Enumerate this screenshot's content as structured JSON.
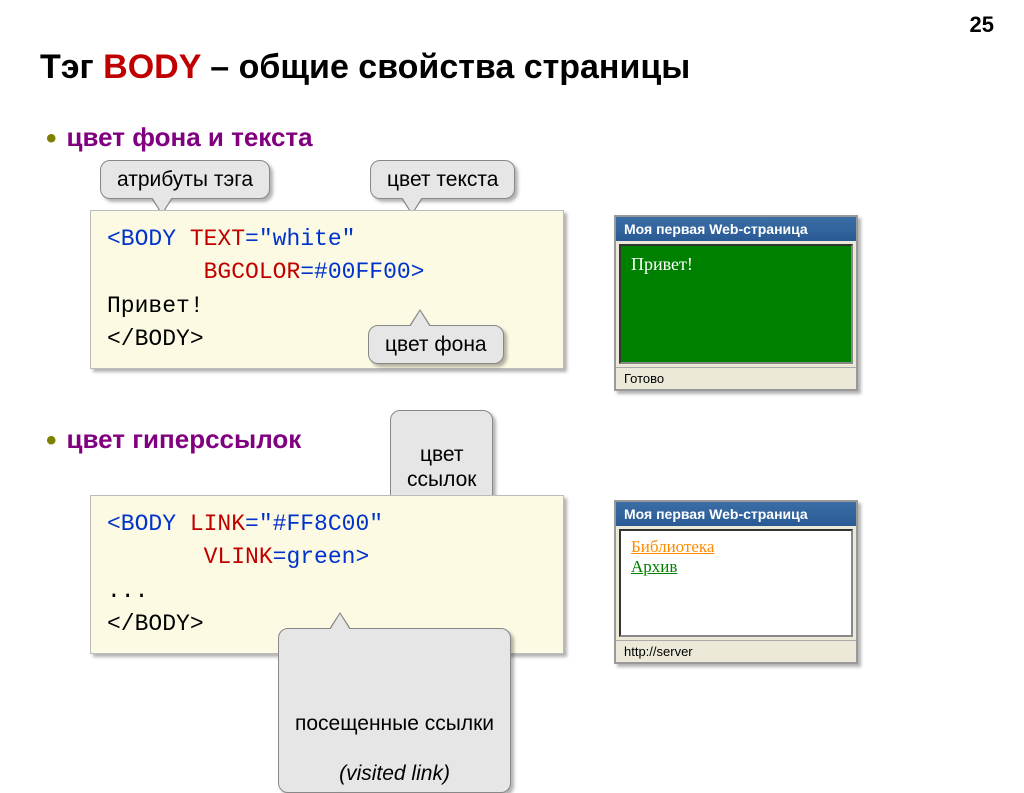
{
  "pageNumber": "25",
  "title": {
    "pre": "Тэг ",
    "kw": "BODY",
    "post": " – общие свойства страницы"
  },
  "bullet1": "цвет фона и текста",
  "bullet2": "цвет гиперссылок",
  "callouts": {
    "attrs": "атрибуты тэга",
    "textcolor": "цвет текста",
    "bgcolor": "цвет фона",
    "linkcolor": "цвет\nссылок",
    "visited": "посещенные ссылки\n(visited link)"
  },
  "code1": {
    "l1a": "<BODY ",
    "l1b": "TEXT",
    "l1c": "=\"white\"",
    "l2a": "       ",
    "l2b": "BGCOLOR",
    "l2c": "=#00FF00>",
    "l3": "Привет!",
    "l4": "</BODY>"
  },
  "code2": {
    "l1a": "<BODY ",
    "l1b": "LINK",
    "l1c": "=\"#FF8C00\"",
    "l2a": "       ",
    "l2b": "VLINK",
    "l2c": "=green>",
    "l3": "...",
    "l4": "</BODY>"
  },
  "win1": {
    "title": "Моя первая Web-страница",
    "content": "Привет!",
    "status": "Готово"
  },
  "win2": {
    "title": "Моя первая Web-страница",
    "link1": "Библиотека",
    "link2": "Архив",
    "status": "http://server"
  }
}
